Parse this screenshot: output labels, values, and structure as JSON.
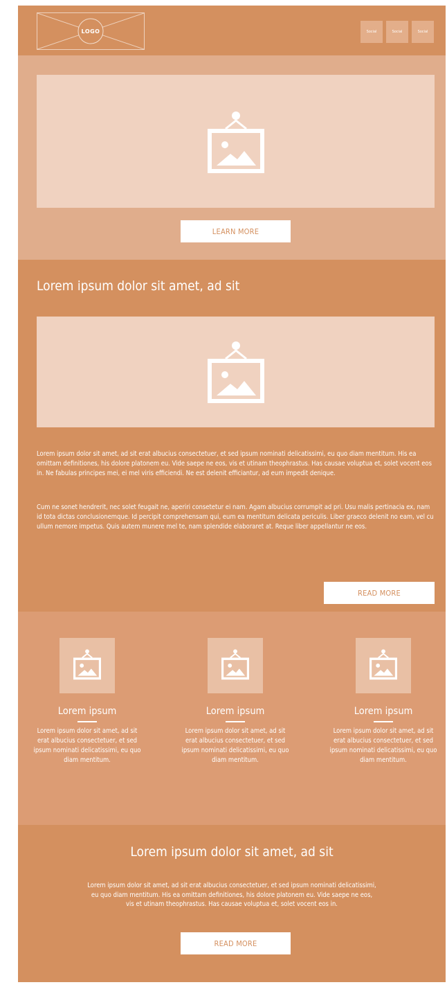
{
  "header": {
    "logo_text": "LOGO",
    "socials": [
      "Social",
      "Social",
      "Social"
    ]
  },
  "hero": {
    "button_label": "LEARN MORE"
  },
  "article": {
    "title": "Lorem ipsum dolor sit amet, ad sit",
    "paragraph1": "Lorem ipsum dolor sit amet, ad sit erat albucius consectetuer, et sed ipsum nominati delicatissimi, eu quo diam mentitum. His ea omittam definitiones, his dolore platonem eu. Vide saepe ne eos, vis et utinam theophrastus. Has causae voluptua et, solet vocent eos in. Ne fabulas principes mei, ei mel viris efficiendi. Ne est delenit efficiantur, ad eum impedit denique.",
    "paragraph2": "Cum ne sonet hendrerit, nec solet feugait ne, aperiri consetetur ei nam. Agam albucius corrumpit ad pri. Usu malis pertinacia ex, nam id tota dictas conclusionemque. Id percipit comprehensam qui, eum ea mentitum delicata periculis. Liber graeco delenit no eam, vel cu ullum nemore impetus. Quis autem munere mel te, nam splendide elaboraret at. Reque liber appellantur ne eos.",
    "button_label": "READ MORE"
  },
  "features": [
    {
      "title": "Lorem ipsum",
      "text": "Lorem ipsum dolor sit amet, ad sit erat albucius consectetuer, et sed ipsum nominati delicatissimi, eu quo diam mentitum."
    },
    {
      "title": "Lorem ipsum",
      "text": "Lorem ipsum dolor sit amet, ad sit erat albucius consectetuer, et sed ipsum nominati delicatissimi, eu quo diam mentitum."
    },
    {
      "title": "Lorem ipsum",
      "text": "Lorem ipsum dolor sit amet, ad sit erat albucius consectetuer, et sed ipsum nominati delicatissimi, eu quo diam mentitum."
    }
  ],
  "cta": {
    "title": "Lorem ipsum dolor sit amet, ad sit",
    "text": "Lorem ipsum dolor sit amet, ad sit erat albucius consectetuer, et sed ipsum nominati delicatissimi, eu quo diam mentitum. His ea omittam definitiones, his dolore platonem eu. Vide saepe ne eos, vis et utinam theophrastus. Has causae voluptua et, solet vocent eos in.",
    "button_label": "READ MORE"
  },
  "icons": {
    "image_placeholder": "image-placeholder-icon"
  },
  "colors": {
    "primary": "#d4905f",
    "hero_band": "#e0ad8c",
    "features_band": "#dc9c74",
    "placeholder_fill": "#f0d2c0",
    "button_text": "#d4905f"
  }
}
